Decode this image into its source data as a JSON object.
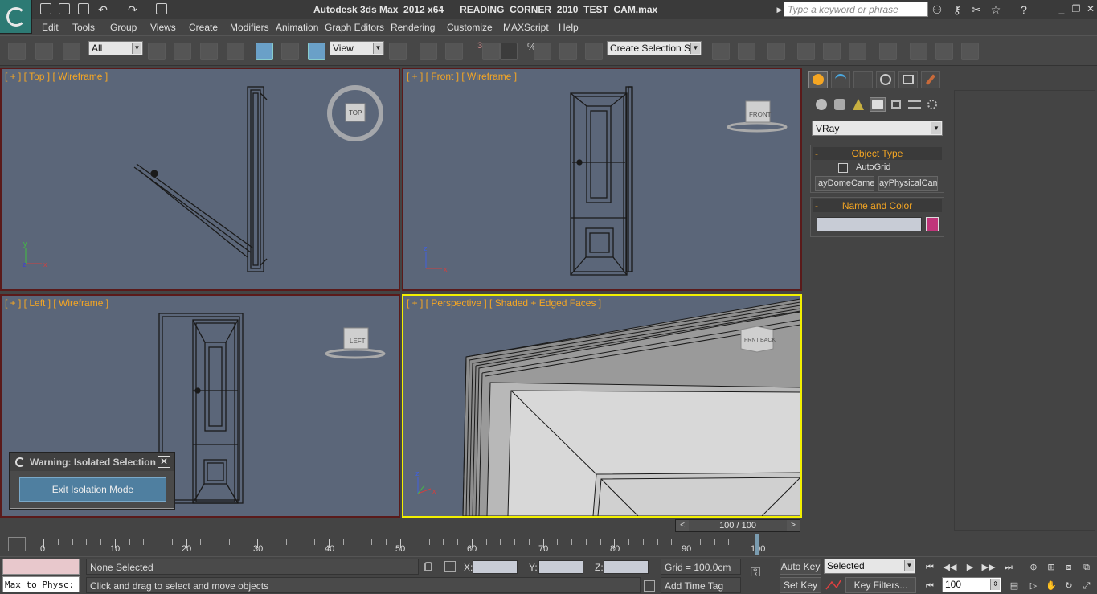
{
  "window": {
    "title": "Autodesk 3ds Max  2012 x64      READING_CORNER_2010_TEST_CAM.max",
    "search_placeholder": "Type a keyword or phrase"
  },
  "menu": {
    "items": [
      "Edit",
      "Tools",
      "Group",
      "Views",
      "Create",
      "Modifiers",
      "Animation",
      "Graph Editors",
      "Rendering",
      "Customize",
      "MAXScript",
      "Help"
    ]
  },
  "toolbar": {
    "selection_filter": "All",
    "reference_coord": "View",
    "snap_number": "3",
    "percent_sign": "%",
    "named_selection": "Create Selection Se"
  },
  "viewports": {
    "top": {
      "label": "[ + ] [ Top ] [ Wireframe ]",
      "cube_label": "TOP"
    },
    "front": {
      "label": "[ + ] [ Front ] [ Wireframe ]",
      "cube_label": "FRONT"
    },
    "left": {
      "label": "[ + ] [ Left ] [ Wireframe ]",
      "cube_label": "LEFT"
    },
    "perspective": {
      "label": "[ + ] [ Perspective ] [ Shaded + Edged Faces ]",
      "cube_label_a": "FRNT",
      "cube_label_b": "BACK"
    }
  },
  "warning_dialog": {
    "title": "Warning: Isolated Selection",
    "button": "Exit Isolation Mode",
    "close_glyph": "✕"
  },
  "command_panel": {
    "category": "VRay",
    "object_type": {
      "title": "Object Type",
      "autogrid_label": "AutoGrid",
      "autogrid_checked": false,
      "buttons": [
        ".ayDomeCame",
        "ayPhysicalCam"
      ]
    },
    "name_color": {
      "title": "Name and Color",
      "name_value": "",
      "color": "#c0357a"
    },
    "collapse_glyph": "-"
  },
  "time_slider": {
    "label": "100 / 100",
    "current_frame": 100,
    "total_frames": 100
  },
  "trackbar": {
    "labels": [
      "0",
      "10",
      "20",
      "30",
      "40",
      "50",
      "60",
      "70",
      "80",
      "90",
      "100"
    ]
  },
  "status": {
    "maxscript_listener": "Max to Physc:",
    "selection": "None Selected",
    "prompt": "Click and drag to select and move objects",
    "x_label": "X:",
    "y_label": "Y:",
    "z_label": "Z:",
    "grid": "Grid = 100.0cm",
    "add_time_tag": "Add Time Tag",
    "auto_key": "Auto Key",
    "set_key": "Set Key",
    "key_mode": "Selected",
    "key_filters": "Key Filters...",
    "frame_value": "100"
  },
  "colors": {
    "viewport_bg": "#5b6679",
    "active_viewport_border": "#f2f000",
    "label_orange": "#f5a623"
  }
}
